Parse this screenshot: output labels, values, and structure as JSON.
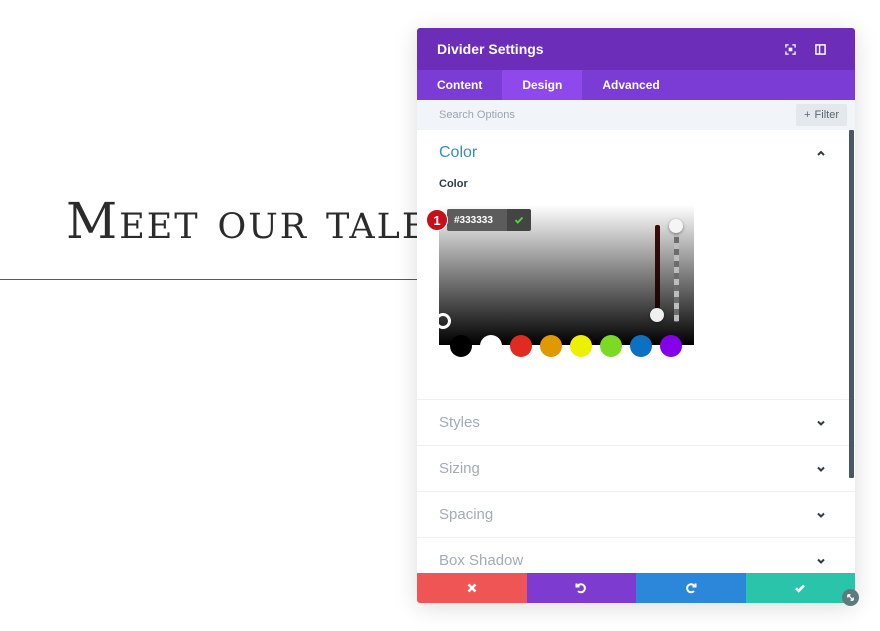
{
  "page": {
    "headline": "Meet our talent"
  },
  "panel": {
    "title": "Divider Settings",
    "header_icons": [
      "focus-icon",
      "sidebar-toggle-icon"
    ],
    "tabs": [
      {
        "label": "Content",
        "active": false
      },
      {
        "label": "Design",
        "active": true
      },
      {
        "label": "Advanced",
        "active": false
      }
    ],
    "search": {
      "placeholder": "Search Options",
      "value": ""
    },
    "filter_label": "Filter",
    "sections": {
      "open": {
        "title": "Color",
        "field_label": "Color",
        "picker": {
          "hex_value": "#333333",
          "annotation_badge": "1",
          "swatches": [
            "#000000",
            "#ffffff",
            "#e02b20",
            "#e09900",
            "#edf000",
            "#7cda24",
            "#0c71c3",
            "#8300e9"
          ]
        }
      },
      "collapsed": [
        {
          "title": "Styles"
        },
        {
          "title": "Sizing"
        },
        {
          "title": "Spacing"
        },
        {
          "title": "Box Shadow"
        }
      ]
    },
    "actions": [
      {
        "name": "discard",
        "icon": "close-icon",
        "color": "#ef5555"
      },
      {
        "name": "undo",
        "icon": "undo-icon",
        "color": "#7e3bd0"
      },
      {
        "name": "redo",
        "icon": "redo-icon",
        "color": "#2b87da"
      },
      {
        "name": "save",
        "icon": "check-icon",
        "color": "#29c4a9"
      }
    ]
  },
  "colors": {
    "header_bg": "#6c2eb9",
    "tabs_bg": "#7b3cd6",
    "active_tab_bg": "#8f48ec",
    "badge": "#c8101a"
  }
}
